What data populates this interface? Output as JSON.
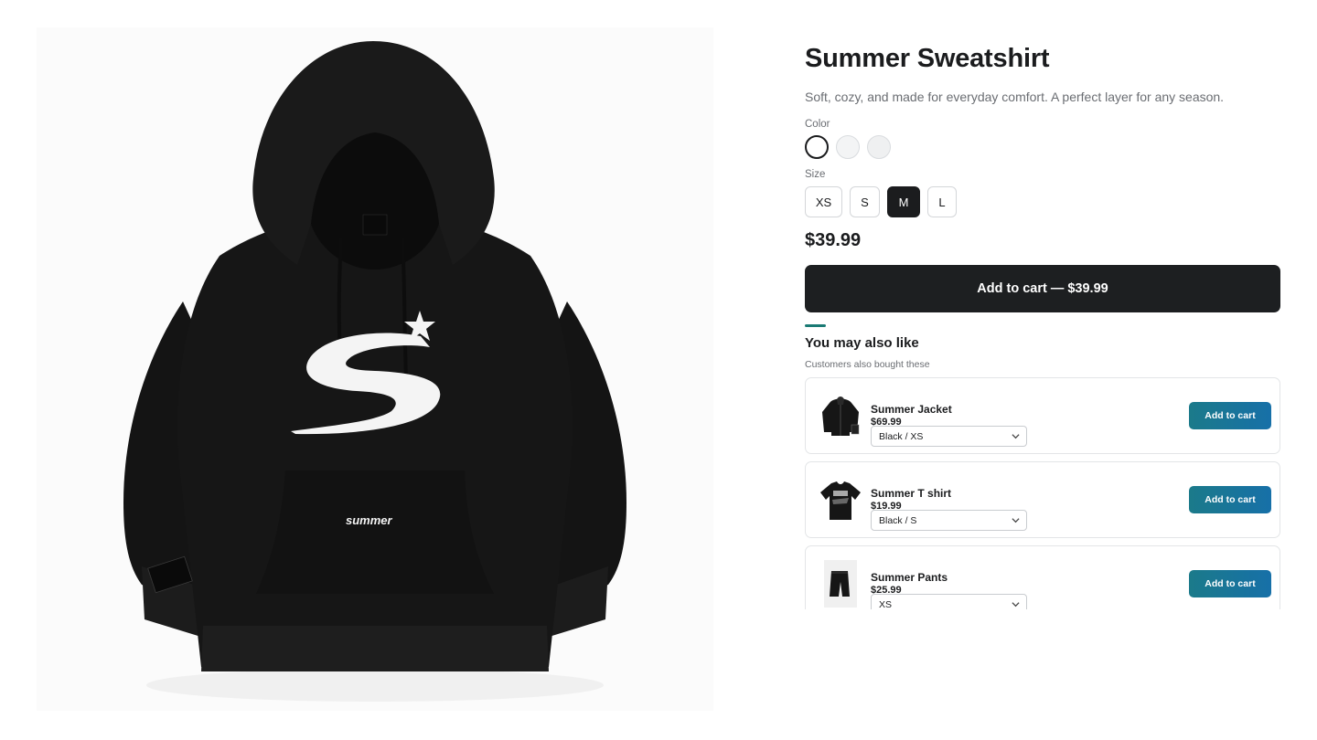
{
  "product": {
    "title": "Summer Sweatshirt",
    "description": "Soft, cozy, and made for everyday comfort. A perfect layer for any season.",
    "price": "$39.99",
    "image_text": "summer",
    "colors_label": "Color",
    "colors": [
      {
        "name": "black",
        "selected": true
      },
      {
        "name": "white",
        "selected": false
      },
      {
        "name": "grey",
        "selected": false
      }
    ],
    "sizes_label": "Size",
    "sizes": [
      "XS",
      "S",
      "M",
      "L"
    ],
    "selected_size": "M",
    "add_to_cart": "Add to cart — $39.99"
  },
  "recommendations": {
    "title": "You may also like",
    "subtitle": "Customers also bought these",
    "items": [
      {
        "name": "Summer Jacket",
        "price": "$69.99",
        "variant": "Black / XS",
        "button": "Add to cart"
      },
      {
        "name": "Summer T shirt",
        "price": "$19.99",
        "variant": "Black / S",
        "button": "Add to cart"
      },
      {
        "name": "Summer Pants",
        "price": "$25.99",
        "variant": "XS",
        "button": "Add to cart"
      }
    ]
  },
  "colors": {
    "primary_button": "#1d1f21",
    "accent": "#1a7a74",
    "rec_button_start": "#1b7a8a",
    "rec_button_end": "#1770a8"
  }
}
